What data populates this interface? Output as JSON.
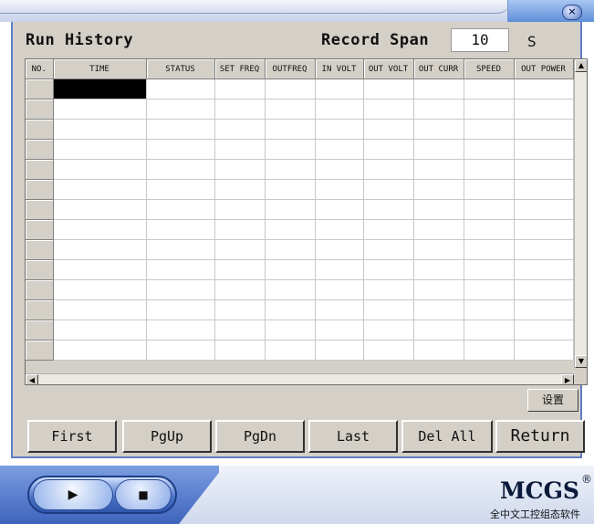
{
  "window": {
    "close_glyph": "×",
    "close_icon": "close-icon"
  },
  "header": {
    "title": "Run History",
    "span_label": "Record Span",
    "span_value": "10",
    "span_unit": "S"
  },
  "grid": {
    "columns": [
      "NO.",
      "TIME",
      "STATUS",
      "SET FREQ",
      "OUTFREQ",
      "IN VOLT",
      "OUT VOLT",
      "OUT CURR",
      "SPEED",
      "OUT POWER"
    ],
    "visible_rows": 14,
    "selected": {
      "row": 1,
      "column": "TIME"
    }
  },
  "scrollbars": {
    "up_glyph": "▲",
    "down_glyph": "▼",
    "left_glyph": "◀",
    "right_glyph": "▶"
  },
  "settings_button": "设置",
  "nav_buttons": [
    "First",
    "PgUp",
    "PgDn",
    "Last",
    "Del All",
    "Return"
  ],
  "player": {
    "play_glyph": "▶",
    "stop_glyph": "■"
  },
  "brand": {
    "name": "MCGS",
    "reg": "®",
    "subtitle": "全中文工控组态软件"
  },
  "colors": {
    "panel": "#d4d0c8",
    "frame_blue": "#5f7cc3",
    "selection": "#000000"
  }
}
